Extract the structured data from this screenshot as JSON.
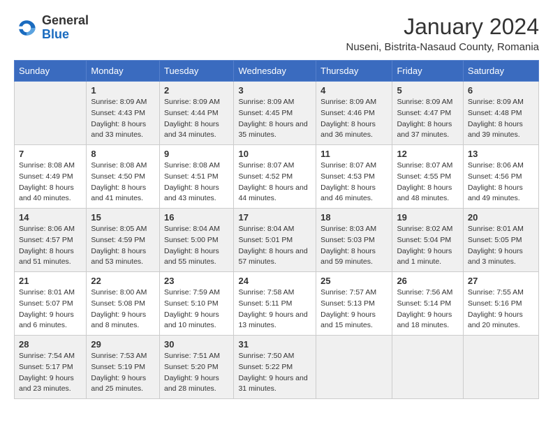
{
  "logo": {
    "general": "General",
    "blue": "Blue"
  },
  "title": "January 2024",
  "location": "Nuseni, Bistrita-Nasaud County, Romania",
  "days_header": [
    "Sunday",
    "Monday",
    "Tuesday",
    "Wednesday",
    "Thursday",
    "Friday",
    "Saturday"
  ],
  "weeks": [
    [
      {
        "num": "",
        "sunrise": "",
        "sunset": "",
        "daylight": ""
      },
      {
        "num": "1",
        "sunrise": "Sunrise: 8:09 AM",
        "sunset": "Sunset: 4:43 PM",
        "daylight": "Daylight: 8 hours and 33 minutes."
      },
      {
        "num": "2",
        "sunrise": "Sunrise: 8:09 AM",
        "sunset": "Sunset: 4:44 PM",
        "daylight": "Daylight: 8 hours and 34 minutes."
      },
      {
        "num": "3",
        "sunrise": "Sunrise: 8:09 AM",
        "sunset": "Sunset: 4:45 PM",
        "daylight": "Daylight: 8 hours and 35 minutes."
      },
      {
        "num": "4",
        "sunrise": "Sunrise: 8:09 AM",
        "sunset": "Sunset: 4:46 PM",
        "daylight": "Daylight: 8 hours and 36 minutes."
      },
      {
        "num": "5",
        "sunrise": "Sunrise: 8:09 AM",
        "sunset": "Sunset: 4:47 PM",
        "daylight": "Daylight: 8 hours and 37 minutes."
      },
      {
        "num": "6",
        "sunrise": "Sunrise: 8:09 AM",
        "sunset": "Sunset: 4:48 PM",
        "daylight": "Daylight: 8 hours and 39 minutes."
      }
    ],
    [
      {
        "num": "7",
        "sunrise": "Sunrise: 8:08 AM",
        "sunset": "Sunset: 4:49 PM",
        "daylight": "Daylight: 8 hours and 40 minutes."
      },
      {
        "num": "8",
        "sunrise": "Sunrise: 8:08 AM",
        "sunset": "Sunset: 4:50 PM",
        "daylight": "Daylight: 8 hours and 41 minutes."
      },
      {
        "num": "9",
        "sunrise": "Sunrise: 8:08 AM",
        "sunset": "Sunset: 4:51 PM",
        "daylight": "Daylight: 8 hours and 43 minutes."
      },
      {
        "num": "10",
        "sunrise": "Sunrise: 8:07 AM",
        "sunset": "Sunset: 4:52 PM",
        "daylight": "Daylight: 8 hours and 44 minutes."
      },
      {
        "num": "11",
        "sunrise": "Sunrise: 8:07 AM",
        "sunset": "Sunset: 4:53 PM",
        "daylight": "Daylight: 8 hours and 46 minutes."
      },
      {
        "num": "12",
        "sunrise": "Sunrise: 8:07 AM",
        "sunset": "Sunset: 4:55 PM",
        "daylight": "Daylight: 8 hours and 48 minutes."
      },
      {
        "num": "13",
        "sunrise": "Sunrise: 8:06 AM",
        "sunset": "Sunset: 4:56 PM",
        "daylight": "Daylight: 8 hours and 49 minutes."
      }
    ],
    [
      {
        "num": "14",
        "sunrise": "Sunrise: 8:06 AM",
        "sunset": "Sunset: 4:57 PM",
        "daylight": "Daylight: 8 hours and 51 minutes."
      },
      {
        "num": "15",
        "sunrise": "Sunrise: 8:05 AM",
        "sunset": "Sunset: 4:59 PM",
        "daylight": "Daylight: 8 hours and 53 minutes."
      },
      {
        "num": "16",
        "sunrise": "Sunrise: 8:04 AM",
        "sunset": "Sunset: 5:00 PM",
        "daylight": "Daylight: 8 hours and 55 minutes."
      },
      {
        "num": "17",
        "sunrise": "Sunrise: 8:04 AM",
        "sunset": "Sunset: 5:01 PM",
        "daylight": "Daylight: 8 hours and 57 minutes."
      },
      {
        "num": "18",
        "sunrise": "Sunrise: 8:03 AM",
        "sunset": "Sunset: 5:03 PM",
        "daylight": "Daylight: 8 hours and 59 minutes."
      },
      {
        "num": "19",
        "sunrise": "Sunrise: 8:02 AM",
        "sunset": "Sunset: 5:04 PM",
        "daylight": "Daylight: 9 hours and 1 minute."
      },
      {
        "num": "20",
        "sunrise": "Sunrise: 8:01 AM",
        "sunset": "Sunset: 5:05 PM",
        "daylight": "Daylight: 9 hours and 3 minutes."
      }
    ],
    [
      {
        "num": "21",
        "sunrise": "Sunrise: 8:01 AM",
        "sunset": "Sunset: 5:07 PM",
        "daylight": "Daylight: 9 hours and 6 minutes."
      },
      {
        "num": "22",
        "sunrise": "Sunrise: 8:00 AM",
        "sunset": "Sunset: 5:08 PM",
        "daylight": "Daylight: 9 hours and 8 minutes."
      },
      {
        "num": "23",
        "sunrise": "Sunrise: 7:59 AM",
        "sunset": "Sunset: 5:10 PM",
        "daylight": "Daylight: 9 hours and 10 minutes."
      },
      {
        "num": "24",
        "sunrise": "Sunrise: 7:58 AM",
        "sunset": "Sunset: 5:11 PM",
        "daylight": "Daylight: 9 hours and 13 minutes."
      },
      {
        "num": "25",
        "sunrise": "Sunrise: 7:57 AM",
        "sunset": "Sunset: 5:13 PM",
        "daylight": "Daylight: 9 hours and 15 minutes."
      },
      {
        "num": "26",
        "sunrise": "Sunrise: 7:56 AM",
        "sunset": "Sunset: 5:14 PM",
        "daylight": "Daylight: 9 hours and 18 minutes."
      },
      {
        "num": "27",
        "sunrise": "Sunrise: 7:55 AM",
        "sunset": "Sunset: 5:16 PM",
        "daylight": "Daylight: 9 hours and 20 minutes."
      }
    ],
    [
      {
        "num": "28",
        "sunrise": "Sunrise: 7:54 AM",
        "sunset": "Sunset: 5:17 PM",
        "daylight": "Daylight: 9 hours and 23 minutes."
      },
      {
        "num": "29",
        "sunrise": "Sunrise: 7:53 AM",
        "sunset": "Sunset: 5:19 PM",
        "daylight": "Daylight: 9 hours and 25 minutes."
      },
      {
        "num": "30",
        "sunrise": "Sunrise: 7:51 AM",
        "sunset": "Sunset: 5:20 PM",
        "daylight": "Daylight: 9 hours and 28 minutes."
      },
      {
        "num": "31",
        "sunrise": "Sunrise: 7:50 AM",
        "sunset": "Sunset: 5:22 PM",
        "daylight": "Daylight: 9 hours and 31 minutes."
      },
      {
        "num": "",
        "sunrise": "",
        "sunset": "",
        "daylight": ""
      },
      {
        "num": "",
        "sunrise": "",
        "sunset": "",
        "daylight": ""
      },
      {
        "num": "",
        "sunrise": "",
        "sunset": "",
        "daylight": ""
      }
    ]
  ]
}
